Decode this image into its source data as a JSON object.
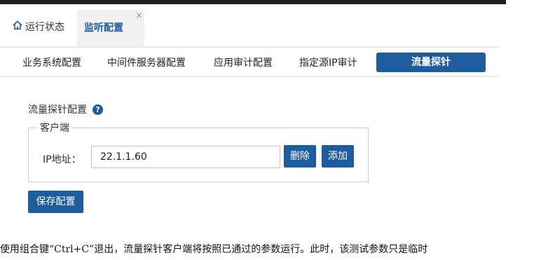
{
  "tabs": {
    "home_label": "运行状态",
    "active_label": "监听配置",
    "close_glyph": "×"
  },
  "subnav": {
    "items": [
      "业务系统配置",
      "中间件服务器配置",
      "应用审计配置",
      "指定源IP审计"
    ],
    "active": "流量探针"
  },
  "section": {
    "title": "流量探针配置",
    "help_glyph": "?"
  },
  "client": {
    "legend": "客户端",
    "ip_label": "IP地址：",
    "ip_value": "22.1.1.60",
    "delete_label": "删除",
    "add_label": "添加"
  },
  "save_label": "保存配置",
  "caption": "使用组合键“Ctrl+C”退出，流量探针客户端将按照已通过的参数运行。此时，该测试参数只是临时",
  "colors": {
    "accent": "#1e5ca0",
    "topbar": "#1f1f1f"
  },
  "icons": {
    "home": "home-icon",
    "close": "close-icon",
    "help": "help-icon"
  }
}
